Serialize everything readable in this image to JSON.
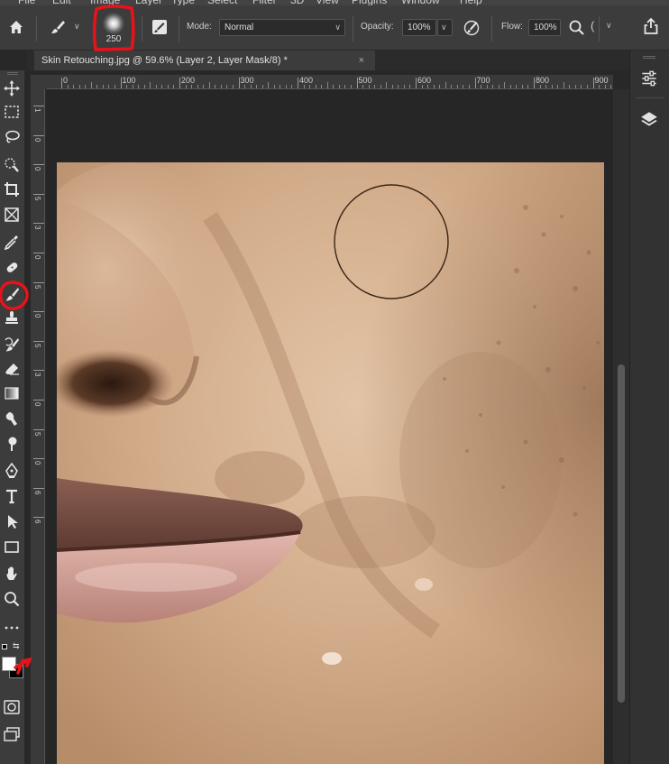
{
  "menu": {
    "items": [
      "File",
      "Edit",
      "Image",
      "Layer",
      "Type",
      "Select",
      "Filter",
      "3D",
      "View",
      "Plugins",
      "Window",
      "Help"
    ]
  },
  "options_bar": {
    "brush_size": "250",
    "mode_label": "Mode:",
    "mode_value": "Normal",
    "opacity_label": "Opacity:",
    "opacity_value": "100%",
    "flow_label": "Flow:",
    "flow_value": "100%"
  },
  "document": {
    "tab_title": "Skin Retouching.jpg @ 59.6% (Layer 2, Layer Mask/8) *",
    "close_glyph": "×"
  },
  "ruler": {
    "h_labels": [
      "0",
      "100",
      "200",
      "300",
      "400",
      "500",
      "600",
      "700",
      "800",
      "900"
    ],
    "v_labels": [
      "1",
      "0",
      "0",
      "5",
      "3",
      "0",
      "5",
      "0",
      "5",
      "3",
      "0",
      "5",
      "0",
      "6",
      "6"
    ]
  },
  "tools": [
    "move-tool",
    "marquee-tool",
    "lasso-tool",
    "quick-select-tool",
    "crop-tool",
    "frame-tool",
    "eyedropper-tool",
    "healing-brush-tool",
    "brush-tool",
    "clone-stamp-tool",
    "history-brush-tool",
    "eraser-tool",
    "gradient-tool",
    "smudge-tool",
    "dodge-tool",
    "pen-tool",
    "type-tool",
    "path-select-tool",
    "rectangle-tool",
    "hand-tool",
    "zoom-tool",
    "more-tools"
  ],
  "colors": {
    "foreground": "#ffffff",
    "background": "#000000",
    "annotation": "#e8121a",
    "brush_cursor": "#3a2516"
  }
}
